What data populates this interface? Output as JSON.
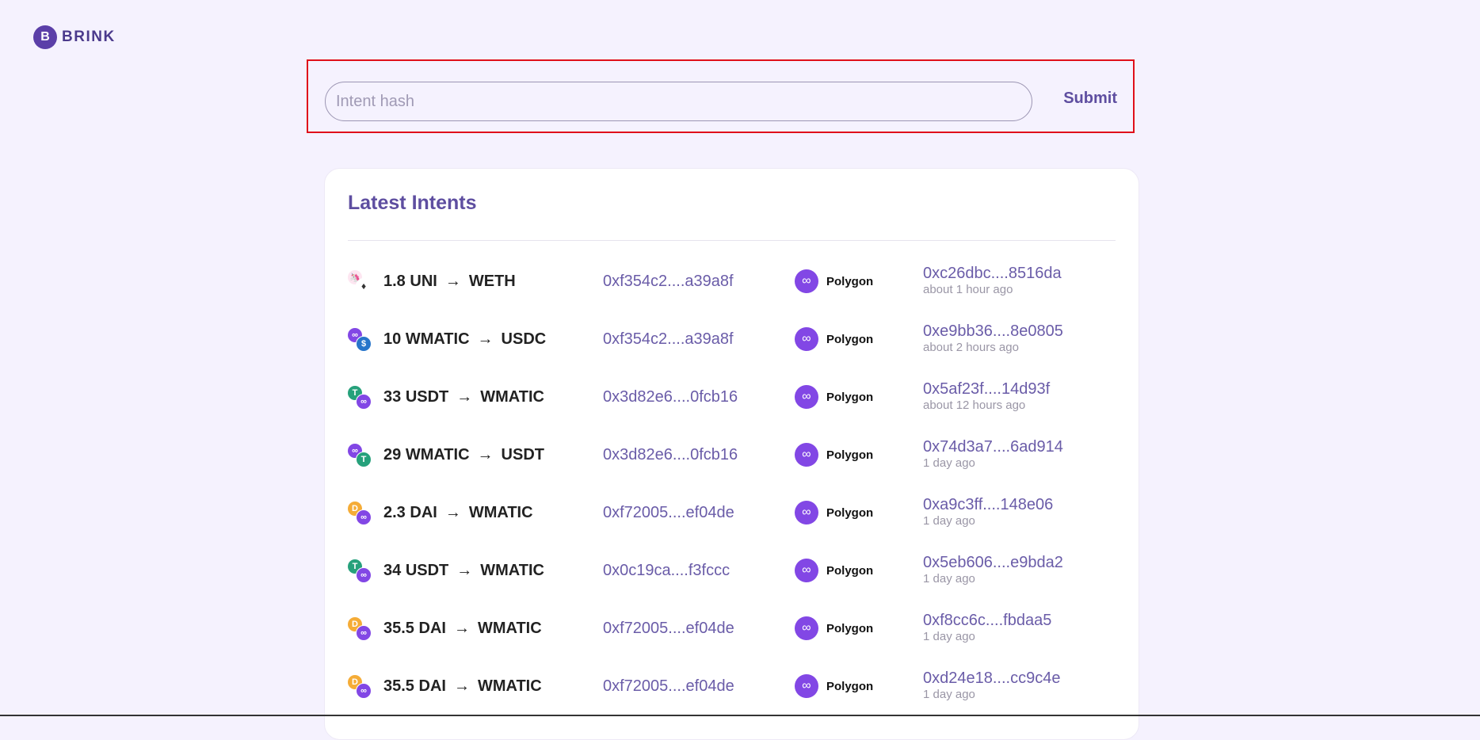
{
  "brand": {
    "logo_glyph": "B",
    "name": "BRINK"
  },
  "search": {
    "placeholder": "Intent hash",
    "value": "",
    "submit_label": "Submit"
  },
  "latest": {
    "title": "Latest Intents",
    "rows": [
      {
        "from_icon": "uni-icon",
        "to_icon": "weth-icon",
        "from_glyph": "🦄",
        "to_glyph": "♦",
        "from_class": "coin-uni",
        "to_class": "coin-weth",
        "amount": "1.8",
        "from_token": "UNI",
        "arrow": "→",
        "to_token": "WETH",
        "signer": "0xf354c2....a39a8f",
        "network": "Polygon",
        "tx_hash": "0xc26dbc....8516da",
        "time": "about 1 hour ago"
      },
      {
        "from_icon": "wmatic-icon",
        "to_icon": "usdc-icon",
        "from_glyph": "∞",
        "to_glyph": "$",
        "from_class": "coin-wmatic",
        "to_class": "coin-usdc",
        "amount": "10",
        "from_token": "WMATIC",
        "arrow": "→",
        "to_token": "USDC",
        "signer": "0xf354c2....a39a8f",
        "network": "Polygon",
        "tx_hash": "0xe9bb36....8e0805",
        "time": "about 2 hours ago"
      },
      {
        "from_icon": "usdt-icon",
        "to_icon": "wmatic-icon",
        "from_glyph": "T",
        "to_glyph": "∞",
        "from_class": "coin-usdt",
        "to_class": "coin-wmatic",
        "amount": "33",
        "from_token": "USDT",
        "arrow": "→",
        "to_token": "WMATIC",
        "signer": "0x3d82e6....0fcb16",
        "network": "Polygon",
        "tx_hash": "0x5af23f....14d93f",
        "time": "about 12 hours ago"
      },
      {
        "from_icon": "wmatic-icon",
        "to_icon": "usdt-icon",
        "from_glyph": "∞",
        "to_glyph": "T",
        "from_class": "coin-wmatic",
        "to_class": "coin-usdt",
        "amount": "29",
        "from_token": "WMATIC",
        "arrow": "→",
        "to_token": "USDT",
        "signer": "0x3d82e6....0fcb16",
        "network": "Polygon",
        "tx_hash": "0x74d3a7....6ad914",
        "time": "1 day ago"
      },
      {
        "from_icon": "dai-icon",
        "to_icon": "wmatic-icon",
        "from_glyph": "D",
        "to_glyph": "∞",
        "from_class": "coin-dai",
        "to_class": "coin-wmatic",
        "amount": "2.3",
        "from_token": "DAI",
        "arrow": "→",
        "to_token": "WMATIC",
        "signer": "0xf72005....ef04de",
        "network": "Polygon",
        "tx_hash": "0xa9c3ff....148e06",
        "time": "1 day ago"
      },
      {
        "from_icon": "usdt-icon",
        "to_icon": "wmatic-icon",
        "from_glyph": "T",
        "to_glyph": "∞",
        "from_class": "coin-usdt",
        "to_class": "coin-wmatic",
        "amount": "34",
        "from_token": "USDT",
        "arrow": "→",
        "to_token": "WMATIC",
        "signer": "0x0c19ca....f3fccc",
        "network": "Polygon",
        "tx_hash": "0x5eb606....e9bda2",
        "time": "1 day ago"
      },
      {
        "from_icon": "dai-icon",
        "to_icon": "wmatic-icon",
        "from_glyph": "D",
        "to_glyph": "∞",
        "from_class": "coin-dai",
        "to_class": "coin-wmatic",
        "amount": "35.5",
        "from_token": "DAI",
        "arrow": "→",
        "to_token": "WMATIC",
        "signer": "0xf72005....ef04de",
        "network": "Polygon",
        "tx_hash": "0xf8cc6c....fbdaa5",
        "time": "1 day ago"
      },
      {
        "from_icon": "dai-icon",
        "to_icon": "wmatic-icon",
        "from_glyph": "D",
        "to_glyph": "∞",
        "from_class": "coin-dai",
        "to_class": "coin-wmatic",
        "amount": "35.5",
        "from_token": "DAI",
        "arrow": "→",
        "to_token": "WMATIC",
        "signer": "0xf72005....ef04de",
        "network": "Polygon",
        "tx_hash": "0xd24e18....cc9c4e",
        "time": "1 day ago"
      }
    ]
  },
  "network_icon_glyph": "∞",
  "colors": {
    "accent": "#5e4ea0",
    "background": "#f5f2fe",
    "highlight_border": "#e0101a",
    "polygon": "#8247e5"
  }
}
